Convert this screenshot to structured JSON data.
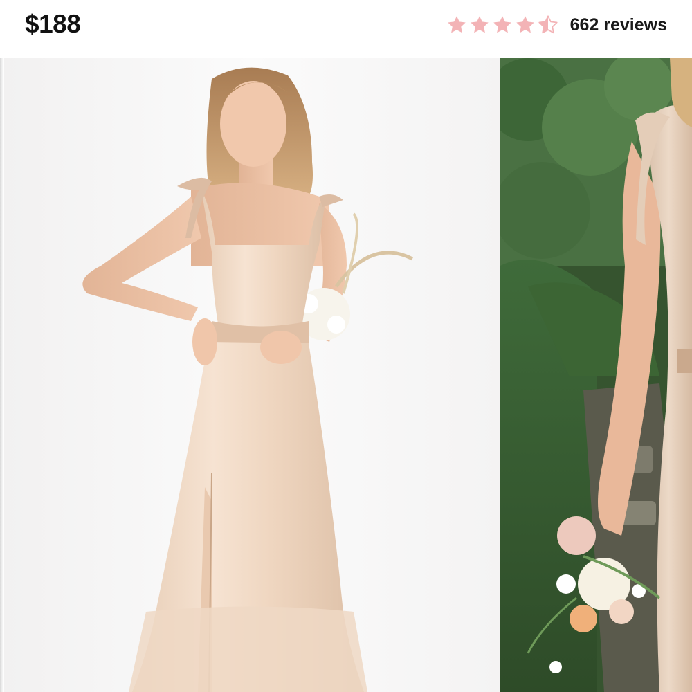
{
  "product": {
    "price": "$188",
    "rating": 4.5,
    "rating_max": 5,
    "reviews_label": "662 reviews",
    "star_color": "#f3b3b6",
    "star_empty_color": "#f6d4d6"
  },
  "gallery": {
    "images": [
      {
        "name": "model-front-studio"
      },
      {
        "name": "model-garden-bouquet"
      }
    ]
  }
}
